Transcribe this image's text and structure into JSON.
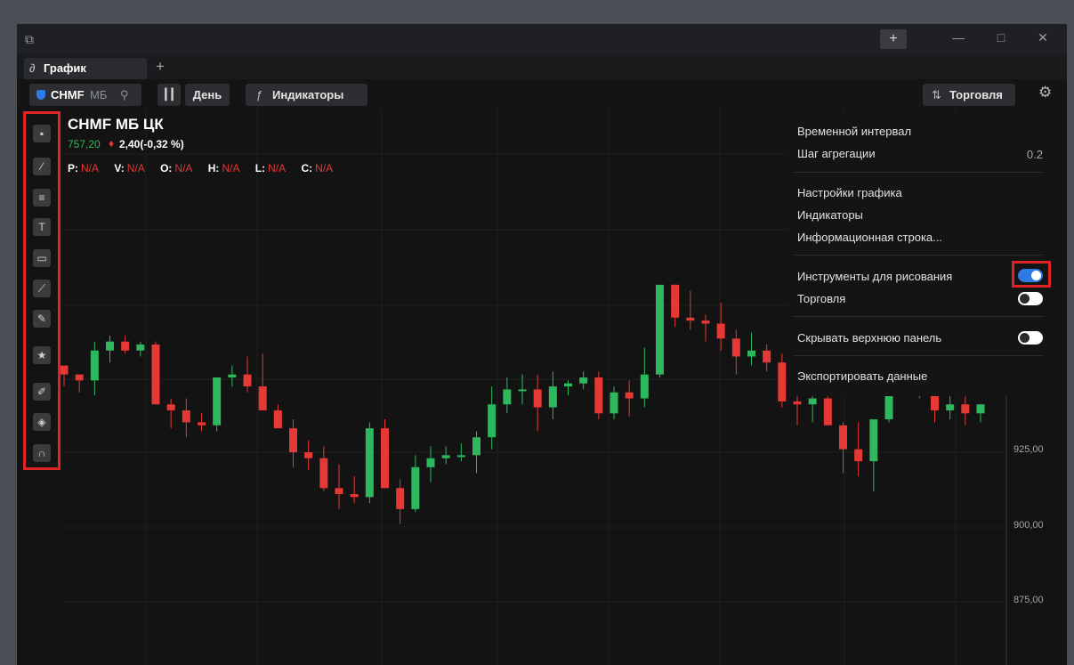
{
  "titlebar": {
    "plus_label": "+",
    "min_label": "—",
    "max_label": "□",
    "close_label": "✕"
  },
  "tabs": [
    {
      "label": "График",
      "icon": "link-icon"
    }
  ],
  "tab_add_label": "+",
  "toolbar": {
    "symbol_ticker": "CHMF",
    "symbol_exchange": "МБ",
    "interval_label": "День",
    "indicators_label": "Индикаторы",
    "trade_label": "Торговля"
  },
  "legend": {
    "title": "CHMF МБ ЦК",
    "price": "757,20",
    "change": "2,40(-0,32 %)",
    "ohlc": [
      {
        "key": "P:",
        "value": "N/A"
      },
      {
        "key": "V:",
        "value": "N/A"
      },
      {
        "key": "O:",
        "value": "N/A"
      },
      {
        "key": "H:",
        "value": "N/A"
      },
      {
        "key": "L:",
        "value": "N/A"
      },
      {
        "key": "C:",
        "value": "N/A"
      }
    ]
  },
  "left_tools": [
    "grid-icon",
    "trend-line-icon",
    "fib-icon",
    "text-icon",
    "rectangle-icon",
    "polyline-icon",
    "brush-icon",
    "star-icon",
    "pen-icon",
    "layers-icon",
    "magnet-icon"
  ],
  "menu": {
    "time_interval": "Временной интервал",
    "aggregation_step": "Шаг агрегации",
    "aggregation_value": "0.2",
    "chart_settings": "Настройки графика",
    "indicators": "Индикаторы",
    "info_line": "Информационная строка...",
    "drawing_tools": "Инструменты для рисования",
    "drawing_tools_on": true,
    "trading": "Торговля",
    "trading_on": false,
    "hide_top_panel": "Скрывать верхнюю панель",
    "hide_top_panel_on": false,
    "export_data": "Экспортировать данные"
  },
  "y_axis_labels": [
    "925,00",
    "900,00",
    "875,00"
  ],
  "colors": {
    "up": "#2db85d",
    "down": "#e53935",
    "accent": "#2f7ae5",
    "highlight": "#e02424"
  },
  "chart_data": {
    "type": "candlestick",
    "y_ticks": [
      925,
      900,
      875
    ],
    "ohlc": [
      [
        954,
        954,
        947,
        951
      ],
      [
        951,
        951,
        945,
        949
      ],
      [
        949,
        962,
        944,
        959
      ],
      [
        959,
        964,
        955,
        962
      ],
      [
        962,
        964,
        958,
        959
      ],
      [
        959,
        962,
        957,
        961
      ],
      [
        961,
        962,
        941,
        941
      ],
      [
        941,
        943,
        933,
        939
      ],
      [
        939,
        943,
        930,
        935
      ],
      [
        935,
        938,
        932,
        934
      ],
      [
        934,
        950,
        932,
        950
      ],
      [
        950,
        954,
        947,
        951
      ],
      [
        951,
        957,
        945,
        947
      ],
      [
        947,
        958,
        939,
        939
      ],
      [
        939,
        941,
        935,
        933
      ],
      [
        933,
        936,
        920,
        925
      ],
      [
        925,
        929,
        919,
        923
      ],
      [
        923,
        927,
        912,
        913
      ],
      [
        913,
        921,
        906,
        911
      ],
      [
        911,
        917,
        908,
        910
      ],
      [
        910,
        935,
        908,
        933
      ],
      [
        933,
        936,
        920,
        913
      ],
      [
        913,
        916,
        901,
        906
      ],
      [
        906,
        924,
        905,
        920
      ],
      [
        920,
        927,
        915,
        923
      ],
      [
        923,
        927,
        921,
        924
      ],
      [
        924,
        928,
        922,
        924
      ],
      [
        924,
        932,
        918,
        930
      ],
      [
        930,
        947,
        926,
        941
      ],
      [
        941,
        950,
        938,
        946
      ],
      [
        946,
        951,
        941,
        946
      ],
      [
        946,
        951,
        932,
        940
      ],
      [
        940,
        952,
        936,
        947
      ],
      [
        947,
        949,
        944,
        948
      ],
      [
        948,
        952,
        946,
        950
      ],
      [
        950,
        952,
        936,
        938
      ],
      [
        938,
        947,
        936,
        945
      ],
      [
        945,
        949,
        937,
        943
      ],
      [
        943,
        960,
        940,
        951
      ],
      [
        951,
        976,
        950,
        981
      ],
      [
        981,
        981,
        967,
        970
      ],
      [
        970,
        979,
        966,
        969
      ],
      [
        969,
        971,
        962,
        968
      ],
      [
        968,
        975,
        959,
        963
      ],
      [
        963,
        966,
        951,
        957
      ],
      [
        957,
        965,
        954,
        959
      ],
      [
        959,
        961,
        952,
        955
      ],
      [
        955,
        958,
        940,
        942
      ],
      [
        942,
        947,
        934,
        941
      ],
      [
        941,
        946,
        935,
        943
      ],
      [
        943,
        948,
        936,
        934
      ],
      [
        934,
        935,
        918,
        926
      ],
      [
        926,
        935,
        917,
        922
      ],
      [
        922,
        936,
        912,
        936
      ],
      [
        936,
        954,
        935,
        945
      ],
      [
        945,
        960,
        950,
        959
      ],
      [
        959,
        961,
        943,
        947
      ],
      [
        947,
        950,
        935,
        939
      ],
      [
        939,
        944,
        936,
        941
      ],
      [
        941,
        946,
        934,
        938
      ],
      [
        938,
        941,
        935,
        941
      ]
    ]
  }
}
